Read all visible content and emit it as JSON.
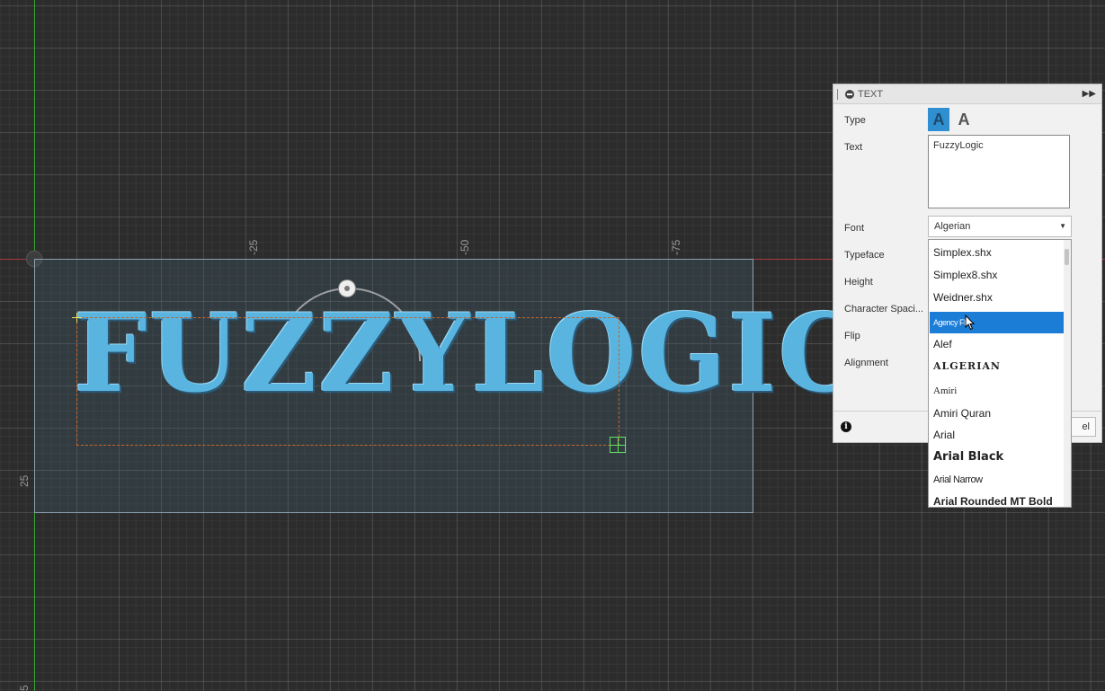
{
  "canvas": {
    "ruler_labels": [
      "-25",
      "-50",
      "-75",
      "25",
      "5"
    ],
    "sketch_text": "FUZZYLOGIC",
    "colors": {
      "background": "#2c2c2c",
      "text_fill": "#5ab4e0",
      "text_box_border": "#c8642a",
      "y_axis": "#3aa83a",
      "x_axis": "#a83a3a"
    }
  },
  "panel": {
    "title": "TEXT",
    "labels": {
      "type": "Type",
      "text": "Text",
      "font": "Font",
      "typeface": "Typeface",
      "height": "Height",
      "character_spacing": "Character Spaci...",
      "flip": "Flip",
      "alignment": "Alignment"
    },
    "type_buttons": [
      "A",
      "A"
    ],
    "text_value": "FuzzyLogic",
    "font_value": "Algerian",
    "cancel_label": "el",
    "font_options": [
      "Simplex.shx",
      "Simplex8.shx",
      "Weidner.shx",
      "Agency FB",
      "Alef",
      "ALGERIAN",
      "Amiri",
      "Amiri Quran",
      "Arial",
      "Arial Black",
      "Arial Narrow",
      "Arial Rounded MT Bold"
    ],
    "selected_option": "Agency FB",
    "highlight_color": "#1c7dd6"
  }
}
